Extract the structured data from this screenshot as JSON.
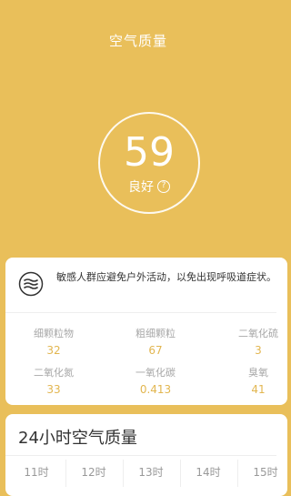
{
  "header": {
    "title": "空气质量",
    "aqi_value": "59",
    "aqi_level": "良好",
    "help_glyph": "?"
  },
  "advice": {
    "icon": "haze-icon",
    "text": "敏感人群应避免户外活动，以免出现呼吸道症状。"
  },
  "pollutants": [
    {
      "name": "细颗粒物",
      "value": "32"
    },
    {
      "name": "粗细颗粒",
      "value": "67"
    },
    {
      "name": "二氧化硫",
      "value": "3"
    },
    {
      "name": "二氧化氮",
      "value": "33"
    },
    {
      "name": "一氧化碳",
      "value": "0.413"
    },
    {
      "name": "臭氧",
      "value": "41"
    }
  ],
  "hourly": {
    "title": "24小时空气质量",
    "hours": [
      "11时",
      "12时",
      "13时",
      "14时",
      "15时"
    ]
  },
  "colors": {
    "accent": "#e9bf5a",
    "value": "#e2b650"
  }
}
